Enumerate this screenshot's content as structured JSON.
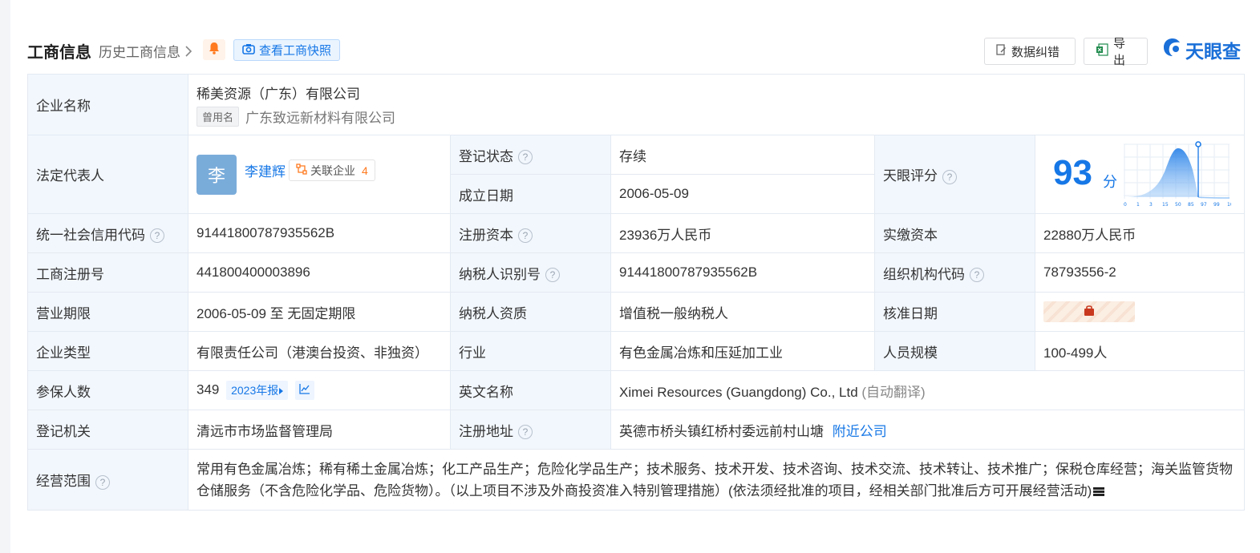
{
  "header": {
    "title": "工商信息",
    "history_link": "历史工商信息",
    "snapshot_button": "查看工商快照",
    "correct_button": "数据纠错",
    "export_button": "导出",
    "brand": "天眼查"
  },
  "rows": {
    "company_name": {
      "label": "企业名称",
      "value": "稀美资源（广东）有限公司",
      "former_tag": "曾用名",
      "former_value": "广东致远新材料有限公司"
    },
    "legal_rep": {
      "label": "法定代表人",
      "avatar_char": "李",
      "name": "李建辉",
      "related_label": "关联企业",
      "related_count": "4"
    },
    "reg_status": {
      "label": "登记状态",
      "value": "存续"
    },
    "founded": {
      "label": "成立日期",
      "value": "2006-05-09"
    },
    "tianyan_score": {
      "label": "天眼评分",
      "score": "93",
      "unit": "分",
      "axis_ticks": [
        "0",
        "1",
        "3",
        "15",
        "50",
        "85",
        "97",
        "99",
        "100"
      ]
    },
    "credit_code": {
      "label": "统一社会信用代码",
      "value": "91441800787935562B"
    },
    "reg_capital": {
      "label": "注册资本",
      "value": "23936万人民币"
    },
    "paid_capital": {
      "label": "实缴资本",
      "value": "22880万人民币"
    },
    "reg_number": {
      "label": "工商注册号",
      "value": "441800400003896"
    },
    "tax_id": {
      "label": "纳税人识别号",
      "value": "91441800787935562B"
    },
    "org_code": {
      "label": "组织机构代码",
      "value": "78793556-2"
    },
    "business_term": {
      "label": "营业期限",
      "value": "2006-05-09 至 无固定期限"
    },
    "taxpayer_type": {
      "label": "纳税人资质",
      "value": "增值税一般纳税人"
    },
    "approval_date": {
      "label": "核准日期"
    },
    "company_type": {
      "label": "企业类型",
      "value": "有限责任公司（港澳台投资、非独资）"
    },
    "industry": {
      "label": "行业",
      "value": "有色金属冶炼和压延加工业"
    },
    "staff_size": {
      "label": "人员规模",
      "value": "100-499人"
    },
    "insured": {
      "label": "参保人数",
      "value": "349",
      "report_tag": "2023年报"
    },
    "english_name": {
      "label": "英文名称",
      "value": "Ximei Resources (Guangdong) Co., Ltd",
      "note": "(自动翻译)"
    },
    "authority": {
      "label": "登记机关",
      "value": "清远市市场监督管理局"
    },
    "address": {
      "label": "注册地址",
      "value": "英德市桥头镇红桥村委远前村山塘",
      "nearby_link": "附近公司"
    },
    "scope": {
      "label": "经营范围",
      "value": "常用有色金属冶炼；稀有稀土金属冶炼；化工产品生产；危险化学品生产；技术服务、技术开发、技术咨询、技术交流、技术转让、技术推广；保税仓库经营；海关监管货物仓储服务（不含危险化学品、危险货物）。（以上项目不涉及外商投资准入特别管理措施）(依法须经批准的项目，经相关部门批准后方可开展经营活动)"
    }
  },
  "colors": {
    "accent": "#1677e6",
    "status": "#1aa35f",
    "label_bg": "#f2f7fd",
    "related_count": "#ff7a1f"
  }
}
